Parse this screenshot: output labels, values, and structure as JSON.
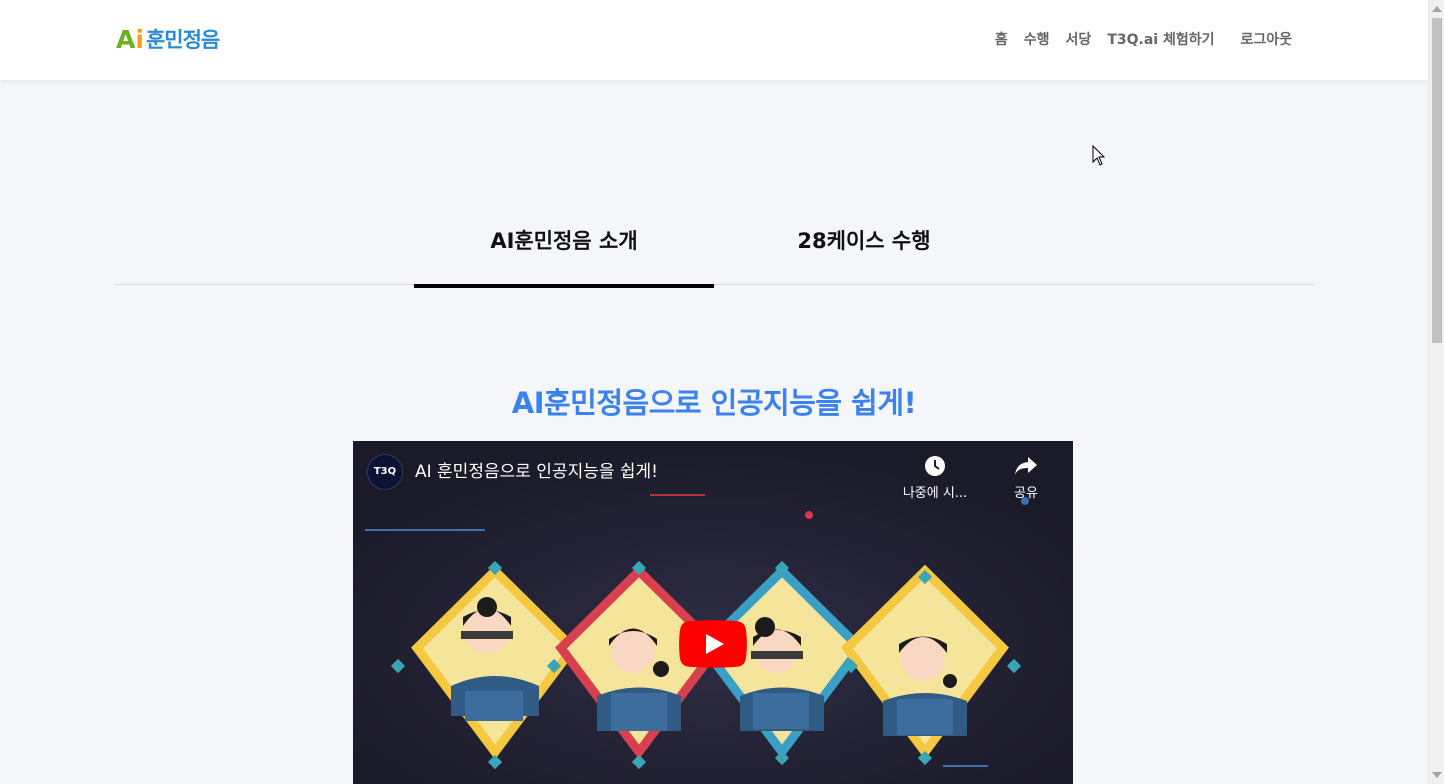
{
  "brand": {
    "logo_a": "A",
    "logo_i": "i",
    "logo_text": "훈민정음"
  },
  "nav": {
    "items": [
      "홈",
      "수행",
      "서당",
      "T3Q.ai 체험하기"
    ],
    "logout": "로그아웃"
  },
  "tabs": [
    {
      "label": "AI훈민정음 소개",
      "active": true
    },
    {
      "label": "28케이스 수행",
      "active": false
    }
  ],
  "headline": "AI훈민정음으로 인공지능을 쉽게!",
  "video": {
    "channel": "T3Q",
    "title": "AI 훈민정음으로 인공지능을 쉽게!",
    "watch_later": "나중에 시...",
    "share": "공유"
  },
  "colors": {
    "accent": "#3b82f0",
    "youtube_red": "#ff0000",
    "logo_green": "#6ab023",
    "logo_orange": "#f2a11b",
    "logo_blue": "#2b8ad6"
  }
}
